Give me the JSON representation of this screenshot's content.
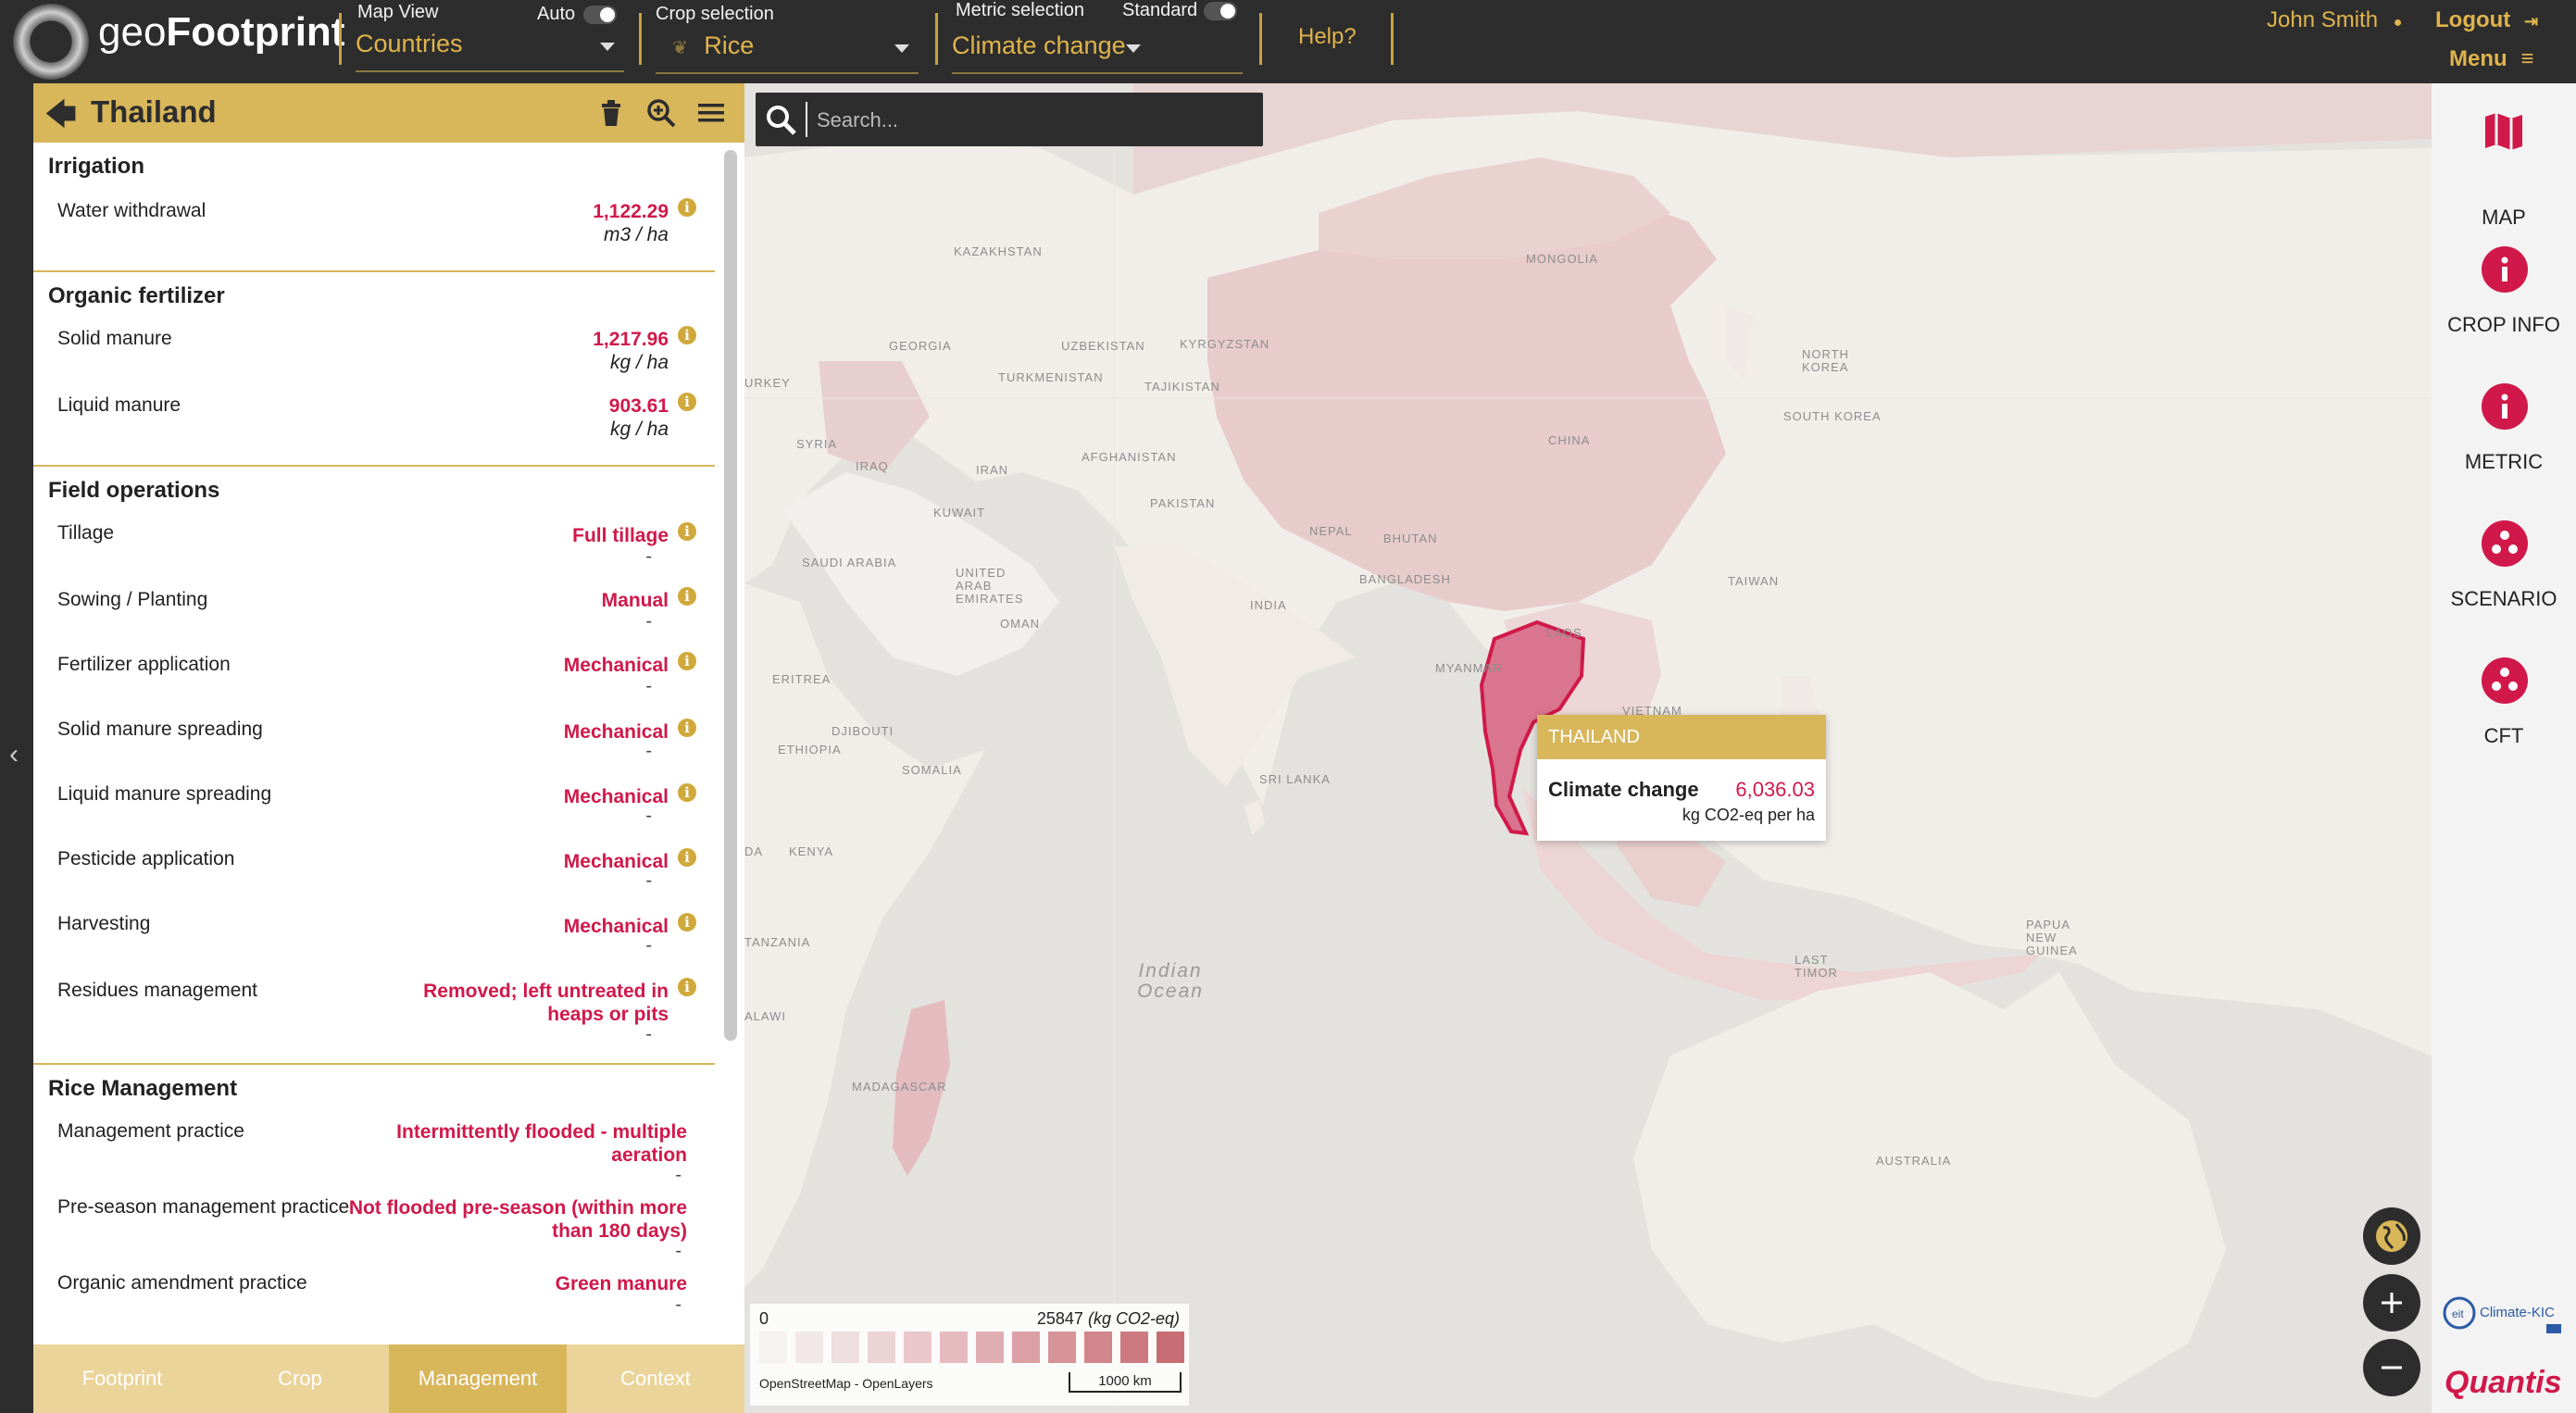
{
  "app": {
    "logo_light": "geo",
    "logo_bold": "Footprint"
  },
  "topbar": {
    "map_view_label": "Map View",
    "map_view_value": "Countries",
    "auto_label": "Auto",
    "crop_label": "Crop selection",
    "crop_value": "Rice",
    "metric_label": "Metric selection",
    "metric_value": "Climate change",
    "standard_label": "Standard",
    "help": "Help?",
    "user": "John Smith",
    "logout": "Logout",
    "menu": "Menu"
  },
  "panel": {
    "title": "Thailand",
    "irrigation": {
      "heading": "Irrigation",
      "rows": [
        {
          "label": "Water withdrawal",
          "value": "1,122.29",
          "unit": "m3 / ha"
        }
      ]
    },
    "organic": {
      "heading": "Organic fertilizer",
      "rows": [
        {
          "label": "Solid manure",
          "value": "1,217.96",
          "unit": "kg / ha"
        },
        {
          "label": "Liquid manure",
          "value": "903.61",
          "unit": "kg / ha"
        }
      ]
    },
    "field": {
      "heading": "Field operations",
      "rows": [
        {
          "label": "Tillage",
          "value": "Full tillage",
          "dash": "-"
        },
        {
          "label": "Sowing / Planting",
          "value": "Manual",
          "dash": "-"
        },
        {
          "label": "Fertilizer application",
          "value": "Mechanical",
          "dash": "-"
        },
        {
          "label": "Solid manure spreading",
          "value": "Mechanical",
          "dash": "-"
        },
        {
          "label": "Liquid manure spreading",
          "value": "Mechanical",
          "dash": "-"
        },
        {
          "label": "Pesticide application",
          "value": "Mechanical",
          "dash": "-"
        },
        {
          "label": "Harvesting",
          "value": "Mechanical",
          "dash": "-"
        },
        {
          "label": "Residues management",
          "value_line1": "Removed; left untreated in",
          "value_line2": "heaps or pits",
          "dash": "-"
        }
      ]
    },
    "rice": {
      "heading": "Rice Management",
      "rows": [
        {
          "label": "Management practice",
          "value_line1": "Intermittently flooded - multiple",
          "value_line2": "aeration",
          "dash": "-"
        },
        {
          "label": "Pre-season management practice",
          "value_line1": "Not flooded pre-season (within more",
          "value_line2": "than 180 days)",
          "dash": "-"
        },
        {
          "label": "Organic amendment practice",
          "value": "Green manure",
          "dash": "-"
        }
      ]
    },
    "info_glyph": "i",
    "tabs": [
      "Footprint",
      "Crop",
      "Management",
      "Context"
    ],
    "active_tab": "Management"
  },
  "map": {
    "search_placeholder": "Search...",
    "labels": {
      "kazakhstan": "KAZAKHSTAN",
      "mongolia": "MONGOLIA",
      "georgia": "GEORGIA",
      "uzbekistan": "UZBEKISTAN",
      "kyrgyzstan": "KYRGYZSTAN",
      "turkey": "URKEY",
      "turkmenistan": "TURKMENISTAN",
      "tajikistan": "TAJIKISTAN",
      "north_korea": "NORTH KOREA",
      "south_korea": "SOUTH KOREA",
      "syria": "SYRIA",
      "iraq": "IRAQ",
      "iran": "IRAN",
      "afghanistan": "AFGHANISTAN",
      "china": "CHINA",
      "kuwait": "KUWAIT",
      "pakistan": "PAKISTAN",
      "nepal": "NEPAL",
      "bhutan": "BHUTAN",
      "saudi_arabia": "SAUDI ARABIA",
      "uae": "UNITED ARAB EMIRATES",
      "bangladesh": "BANGLADESH",
      "taiwan": "TAIWAN",
      "india": "INDIA",
      "oman": "OMAN",
      "laos": "LAOS",
      "myanmar": "MYANMAR",
      "eritrea": "ERITREA",
      "vietnam": "VIETNAM",
      "djibouti": "DJIBOUTI",
      "ethiopia": "ETHIOPIA",
      "somalia": "SOMALIA",
      "sri_lanka": "SRI LANKA",
      "kenya": "KENYA",
      "tanzania": "TANZANIA",
      "papua": "PAPUA NEW GUINEA",
      "malawi": "ALAWI",
      "madagascar": "MADAGASCAR",
      "east_timor": "LAST TIMOR",
      "australia": "AUSTRALIA",
      "da": "DA"
    },
    "ocean": "Indian Ocean",
    "popup": {
      "country": "THAILAND",
      "metric": "Climate change",
      "value": "6,036.03",
      "unit": "kg CO2-eq per ha"
    },
    "legend": {
      "min": "0",
      "max": "25847",
      "unit": "(kg CO2-eq)",
      "colors": [
        "#f5f2f1",
        "#f2e8e8",
        "#efdedf",
        "#ecd3d5",
        "#e9c7ca",
        "#e5bbbf",
        "#e0adb2",
        "#dba0a5",
        "#d69398",
        "#d1868c",
        "#cc7a80",
        "#c86d74"
      ],
      "attribution": "OpenStreetMap - OpenLayers",
      "scale": "1000 km"
    },
    "highlight_color": "#d0194a"
  },
  "rail": {
    "items": [
      "MAP",
      "CROP INFO",
      "METRIC",
      "SCENARIO",
      "CFT"
    ],
    "partner_logo": "Climate-KIC",
    "brand": "Quantis"
  }
}
